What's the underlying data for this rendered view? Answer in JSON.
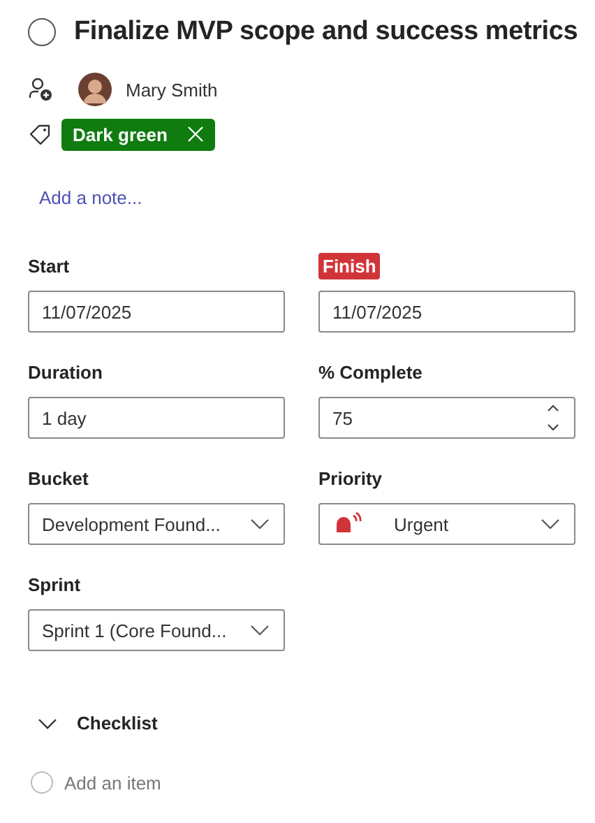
{
  "task": {
    "title": "Finalize MVP scope and success metrics",
    "completed": false
  },
  "assignee": {
    "name": "Mary Smith"
  },
  "labels": [
    {
      "text": "Dark green",
      "color": "#107c10"
    }
  ],
  "note_link": "Add a note...",
  "fields": [
    {
      "label": "Start",
      "kind": "text",
      "value": "11/07/2025",
      "overdue": false
    },
    {
      "label": "Finish",
      "kind": "text",
      "value": "11/07/2025",
      "overdue": true
    },
    {
      "label": "Duration",
      "kind": "text",
      "value": "1 day",
      "overdue": false
    },
    {
      "label": "% Complete",
      "kind": "number",
      "value": "75",
      "overdue": false
    },
    {
      "label": "Bucket",
      "kind": "dropdown",
      "value": "Development Found...",
      "overdue": false
    },
    {
      "label": "Priority",
      "kind": "priority",
      "value": "Urgent",
      "overdue": false
    },
    {
      "label": "Sprint",
      "kind": "dropdown",
      "value": "Sprint 1 (Core Found...",
      "overdue": false
    }
  ],
  "checklist": {
    "title": "Checklist",
    "expanded": true,
    "placeholder": "Add an item",
    "new_item_checked": false
  }
}
